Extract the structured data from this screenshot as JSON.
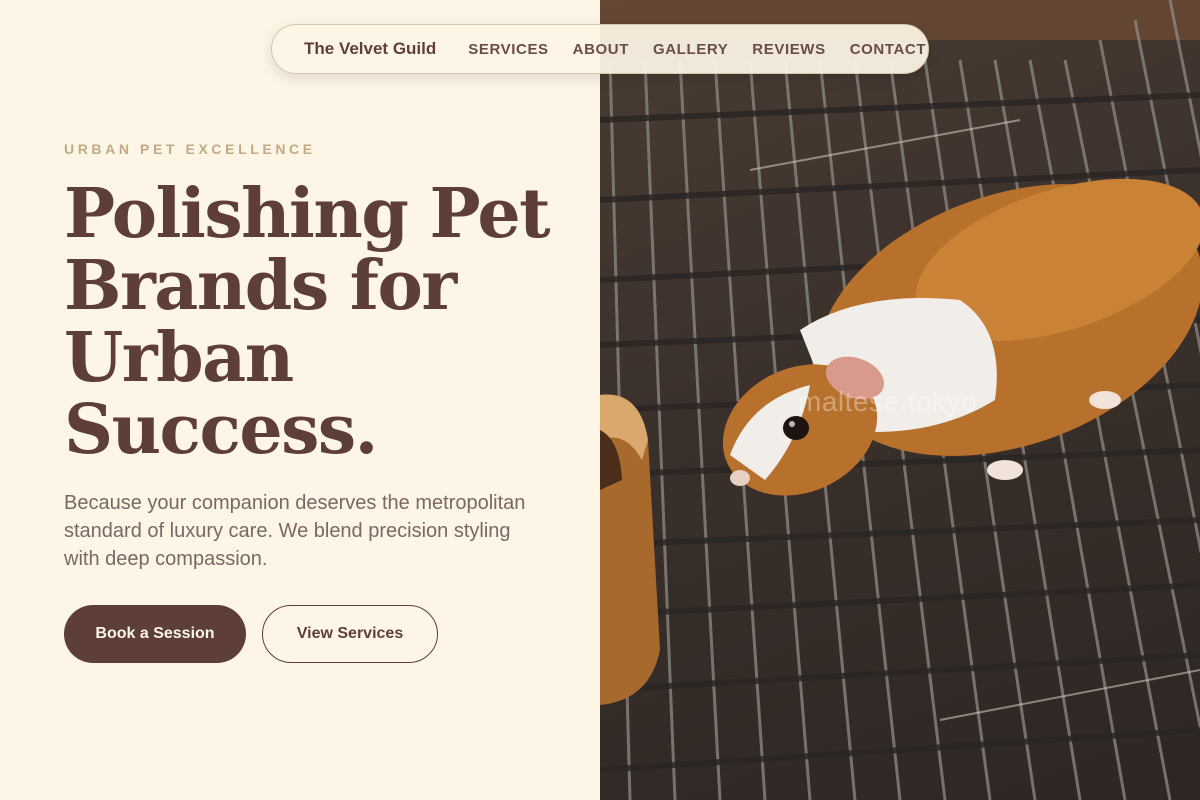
{
  "nav": {
    "brand": "The Velvet Guild",
    "links": [
      "SERVICES",
      "ABOUT",
      "GALLERY",
      "REVIEWS",
      "CONTACT"
    ]
  },
  "hero": {
    "eyebrow": "URBAN PET EXCELLENCE",
    "headline_lines": [
      "Polishing Pet",
      "Brands for",
      "Urban",
      "Success."
    ],
    "lede": "Because your companion deserves the metropolitan standard of luxury care. We blend precision styling with deep compassion.",
    "primary_cta": "Book a Session",
    "secondary_cta": "View Services"
  },
  "photo": {
    "subject": "guinea-pig-on-wire-grate",
    "watermark": "maltese.tokyo"
  },
  "colors": {
    "background": "#fdf5e6",
    "primary": "#5e3f38",
    "accent": "#c2aa84",
    "body_text": "#7a6864"
  }
}
